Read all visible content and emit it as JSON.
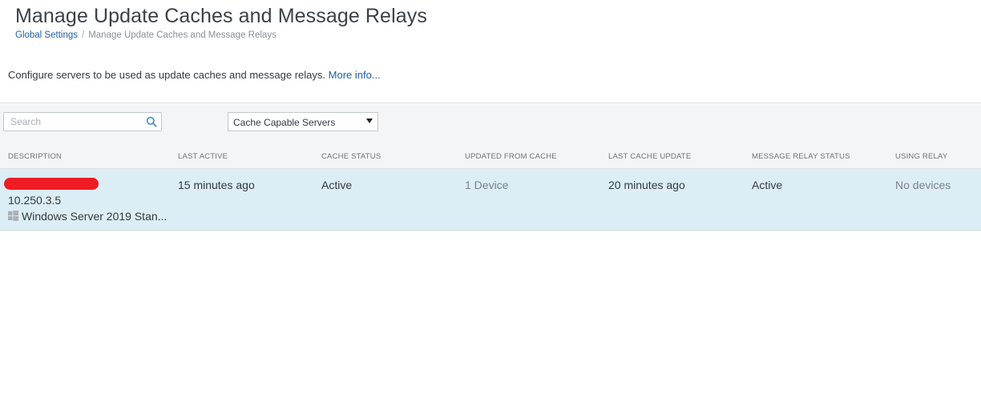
{
  "header": {
    "title": "Manage Update Caches and Message Relays",
    "breadcrumb": {
      "parent": "Global Settings",
      "separator": "/",
      "current": "Manage Update Caches and Message Relays"
    }
  },
  "intro": {
    "text": "Configure servers to be used as update caches and message relays.",
    "more_link": "More info..."
  },
  "toolbar": {
    "search_placeholder": "Search",
    "search_value": "",
    "filter_selected": "Cache Capable Servers"
  },
  "table": {
    "columns": [
      "DESCRIPTION",
      "LAST ACTIVE",
      "CACHE STATUS",
      "UPDATED FROM CACHE",
      "LAST CACHE UPDATE",
      "MESSAGE RELAY STATUS",
      "USING RELAY"
    ],
    "rows": [
      {
        "name_redacted": true,
        "ip": "10.250.3.5",
        "os": "Windows Server 2019 Stan...",
        "os_icon": "windows-icon",
        "last_active": "15 minutes ago",
        "cache_status": "Active",
        "updated_from_cache": "1 Device",
        "last_cache_update": "20 minutes ago",
        "message_relay_status": "Active",
        "using_relay": "No devices"
      }
    ]
  },
  "colors": {
    "link": "#1f5fa0",
    "row_selected": "#dcedf5",
    "redaction": "#ee1c25",
    "toolbar_bg": "#f4f5f6"
  }
}
